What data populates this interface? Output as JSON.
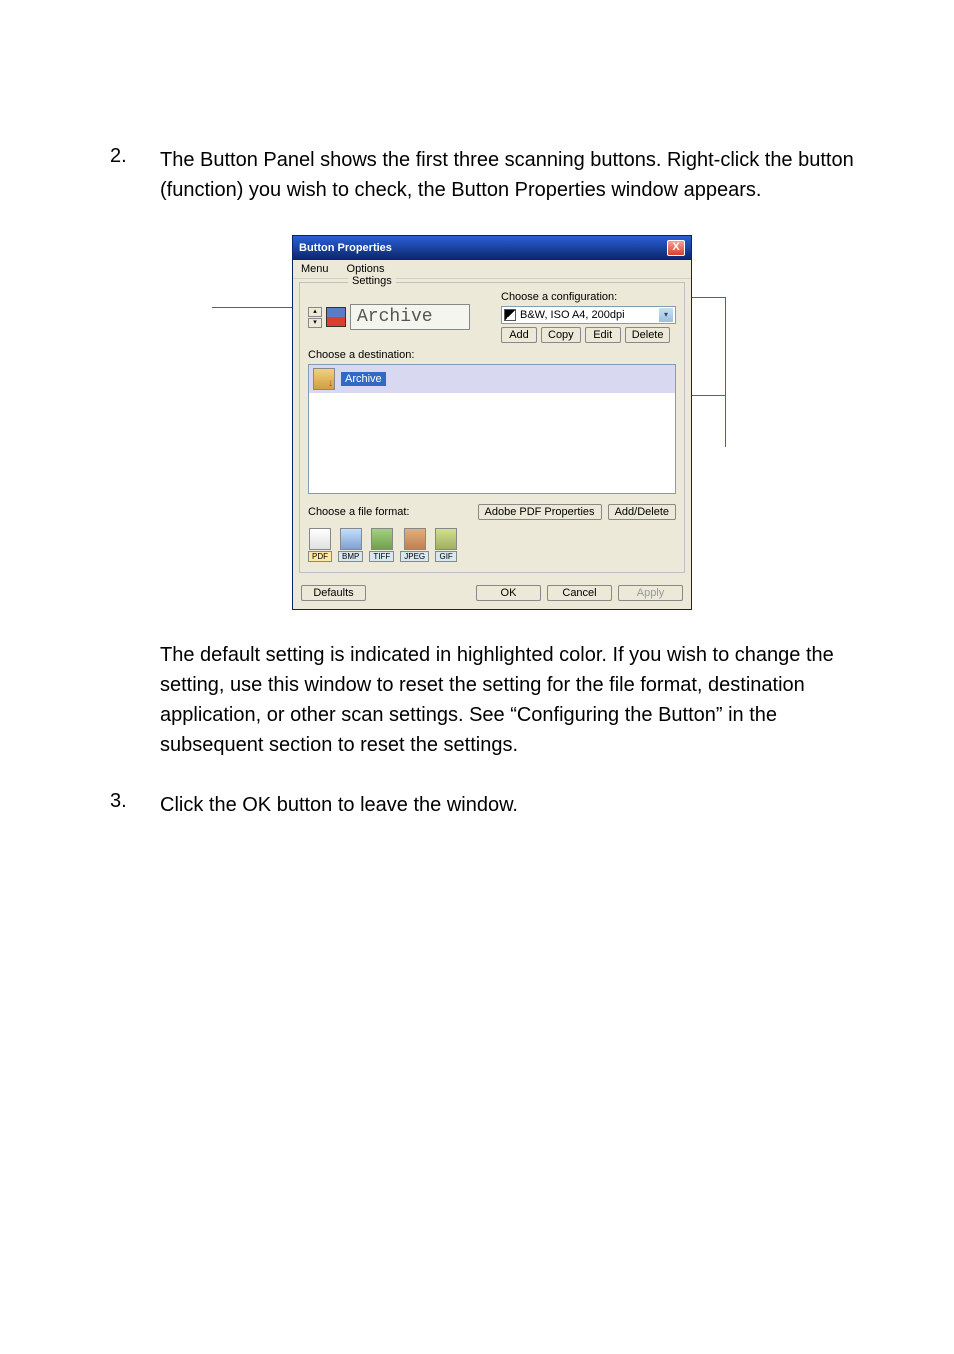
{
  "list": {
    "item2": {
      "num": "2.",
      "text": "The Button Panel shows the first three scanning buttons. Right-click the button (function) you wish to check, the Button Properties window appears."
    },
    "item3": {
      "num": "3.",
      "text": "Click the OK button to leave the window."
    }
  },
  "paragraph": "The default setting is indicated in highlighted color.   If you wish to change the setting, use this window to reset the setting for the file format, destination application, or other scan settings. See “Configuring the Button” in the subsequent section to reset the settings.",
  "dialog": {
    "title": "Button Properties",
    "close": "X",
    "menu": {
      "m1": "Menu",
      "m2": "Options",
      "settings_tab": "Settings"
    },
    "archive_name": "Archive",
    "config": {
      "label": "Choose a configuration:",
      "selected": "B&W, ISO A4, 200dpi",
      "buttons": {
        "add": "Add",
        "copy": "Copy",
        "edit": "Edit",
        "delete": "Delete"
      }
    },
    "dest": {
      "label": "Choose a destination:",
      "item": "Archive"
    },
    "format": {
      "label": "Choose a file format:",
      "btn1": "Adobe PDF Properties",
      "btn2": "Add/Delete",
      "formats": {
        "pdf": "PDF",
        "bmp": "BMP",
        "tiff": "TIFF",
        "jpeg": "JPEG",
        "gif": "GIF"
      }
    },
    "bottom": {
      "defaults": "Defaults",
      "ok": "OK",
      "cancel": "Cancel",
      "apply": "Apply"
    }
  }
}
